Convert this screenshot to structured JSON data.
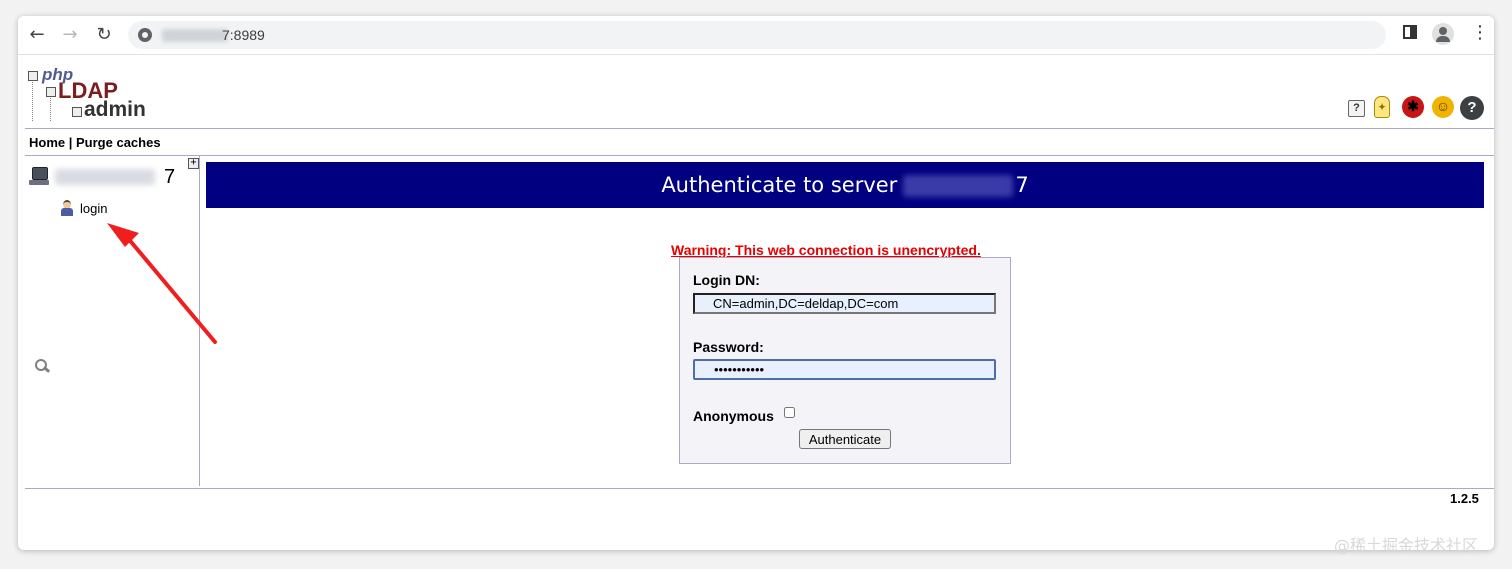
{
  "browser": {
    "url_suffix": "7:8989",
    "back_icon": "arrow-left",
    "forward_icon": "arrow-right",
    "reload_icon": "reload",
    "site_info_icon": "site-info",
    "side_panel_icon": "side-panel",
    "profile_icon": "profile",
    "menu_icon": "kebab-menu"
  },
  "header": {
    "logo": {
      "php": "php",
      "ldap": "LDAP",
      "admin": "admin"
    },
    "icons": [
      "help-icon",
      "idea-icon",
      "bug-icon",
      "donate-icon",
      "about-icon"
    ]
  },
  "menu": {
    "home": "Home",
    "separator": "|",
    "purge": "Purge caches"
  },
  "tree": {
    "server_suffix": "7",
    "expand_glyph": "+",
    "login_label": "login"
  },
  "main": {
    "banner_prefix": "Authenticate to server",
    "banner_suffix": "7",
    "warning": "Warning: This web connection is unencrypted.",
    "login_dn_label": "Login DN:",
    "login_dn_value": "CN=admin,DC=deldap,DC=com",
    "password_label": "Password:",
    "password_value": "•••••••••••",
    "anonymous_label": "Anonymous",
    "anonymous_checked": false,
    "authenticate_button": "Authenticate"
  },
  "footer": {
    "version": "1.2.5"
  },
  "watermark": "@稀土掘金技术社区",
  "colors": {
    "banner_bg": "#000080",
    "warning": "#e60000",
    "rule": "#a9a9c9",
    "annotation_arrow": "#f01e1e"
  }
}
